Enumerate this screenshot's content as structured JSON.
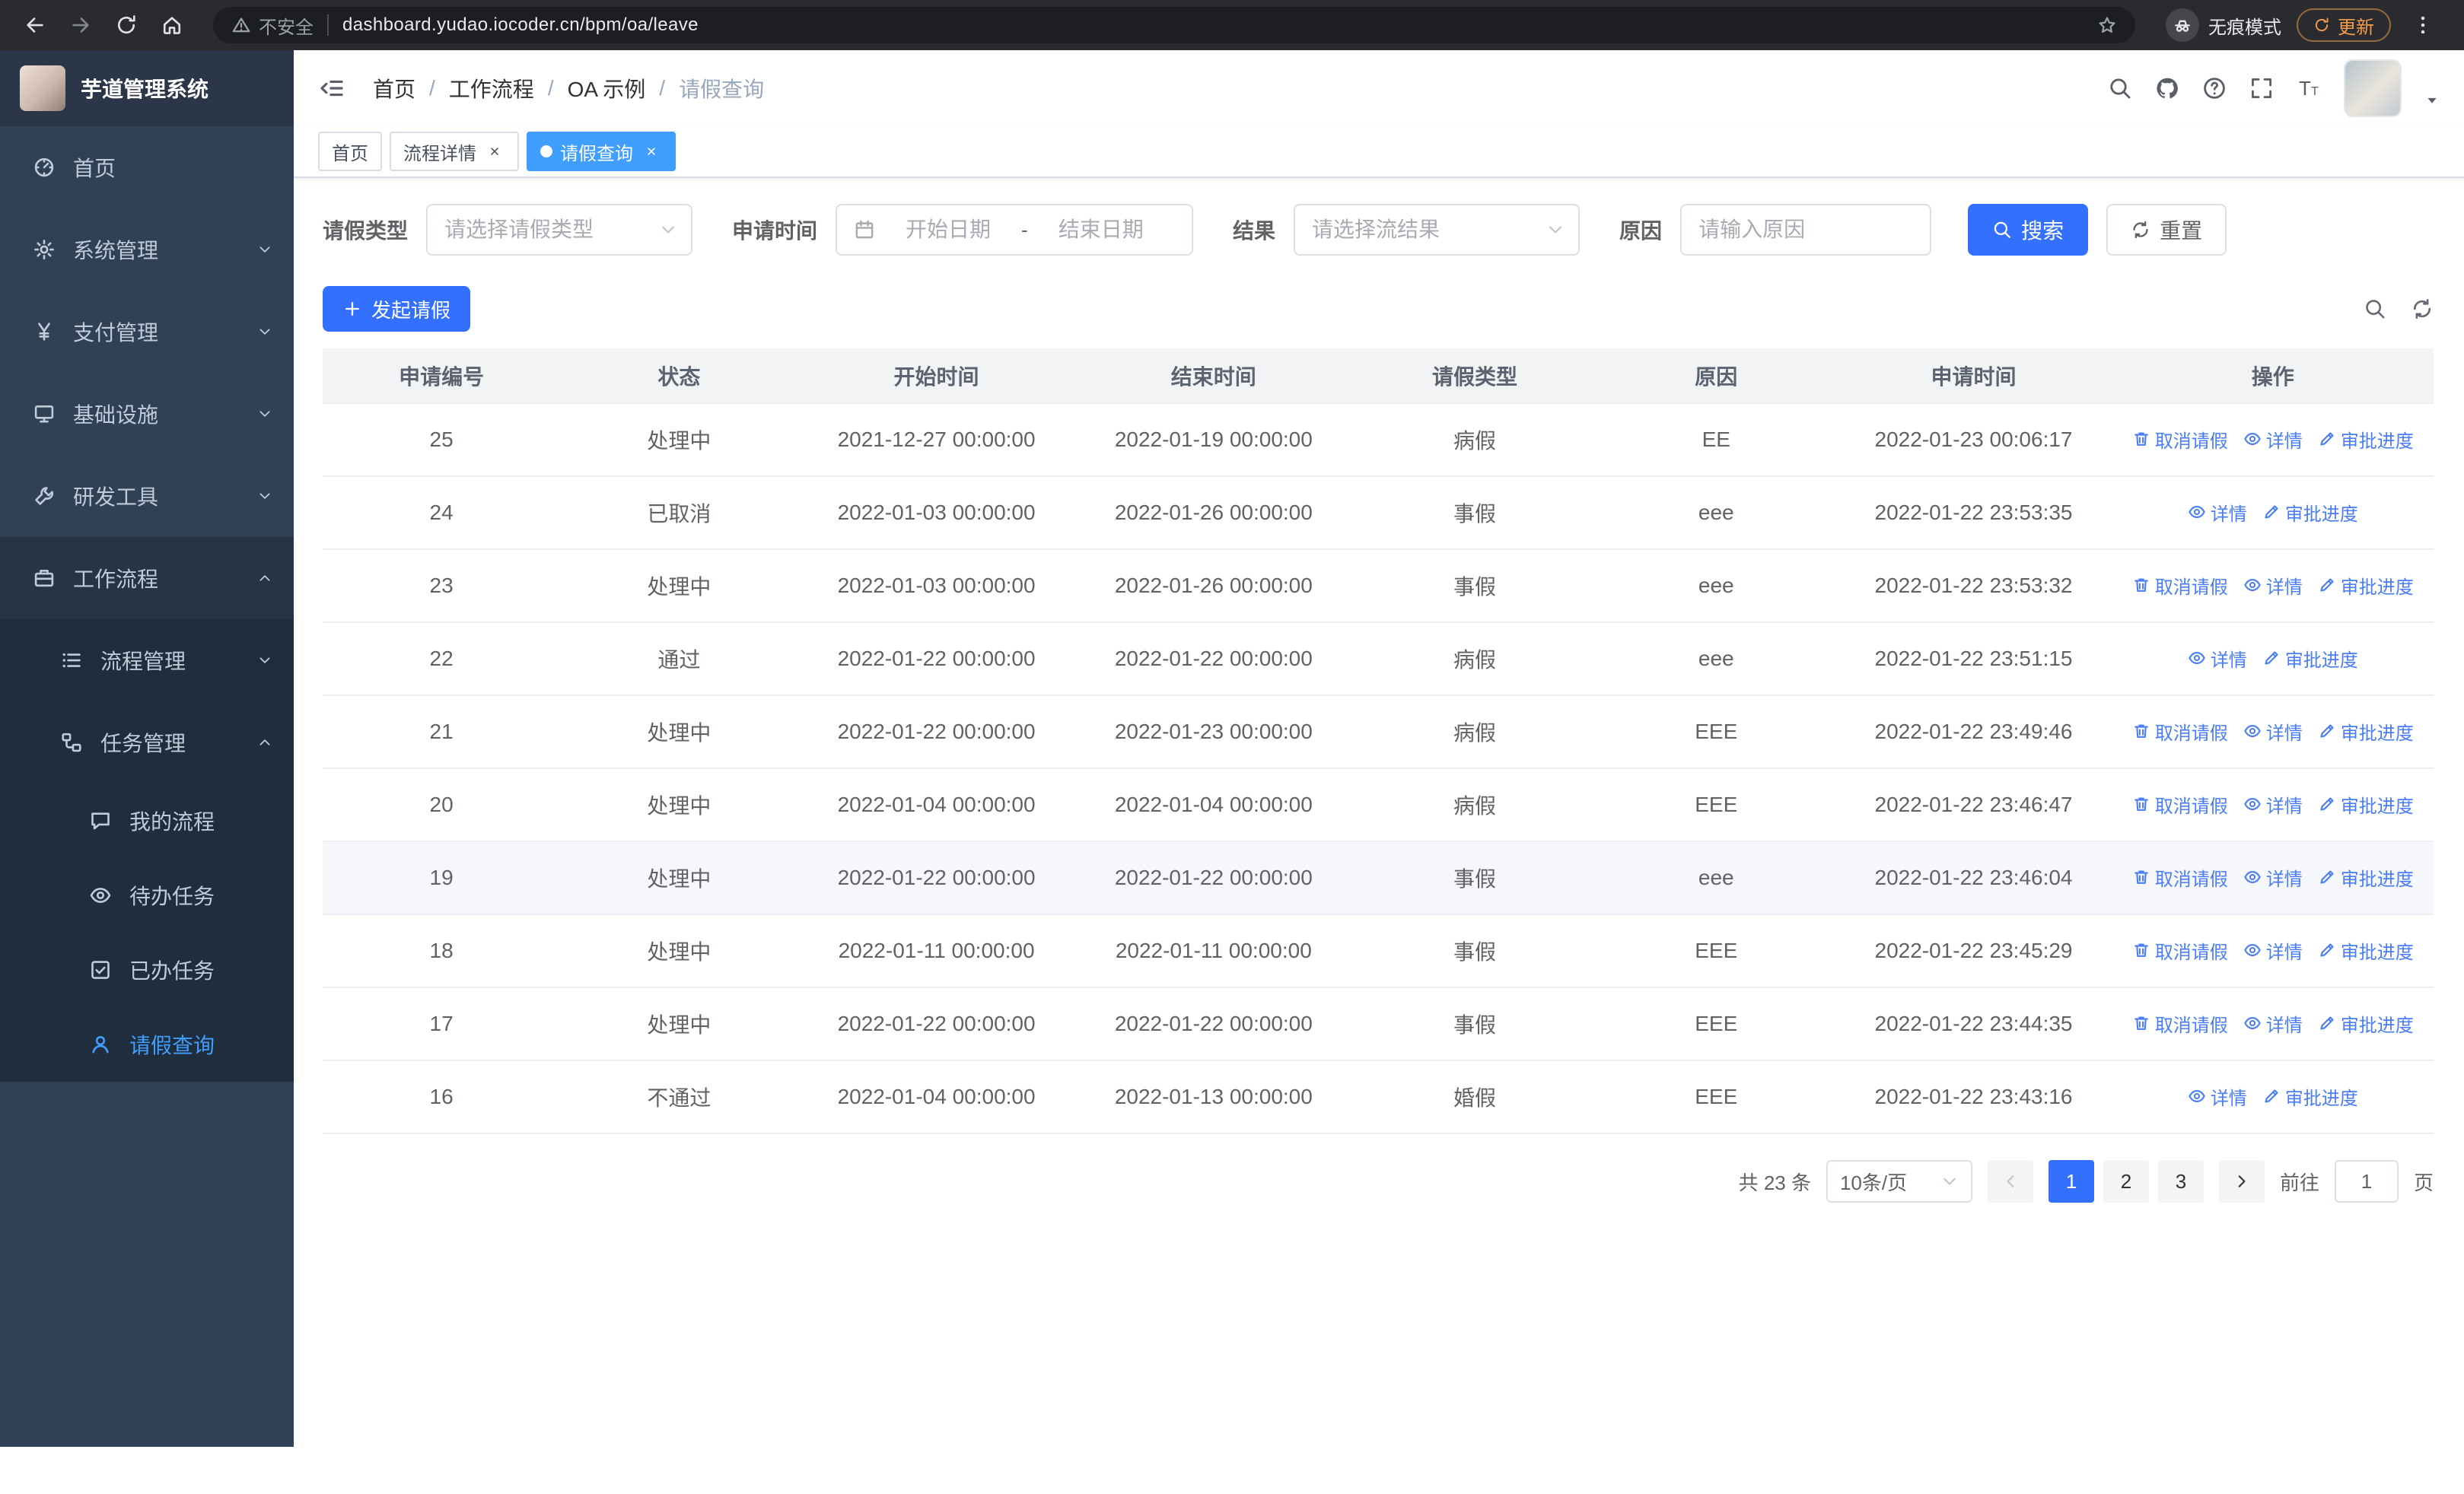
{
  "colors": {
    "primary_button": "#3370ff",
    "link_blue": "#4a7df6",
    "tag_active": "#409eff",
    "sidebar_bg": "#304156",
    "submenu_bg": "#1f2d3d",
    "sidebar_text": "#bfcbd9"
  },
  "browser": {
    "security_warning": "不安全",
    "url": "dashboard.yudao.iocoder.cn/bpm/oa/leave",
    "incognito_label": "无痕模式",
    "update_label": "更新"
  },
  "sidebar": {
    "logo_title": "芋道管理系统",
    "items": [
      {
        "label": "首页",
        "icon": "dashboard-icon",
        "level": 1
      },
      {
        "label": "系统管理",
        "icon": "gear-icon",
        "level": 1,
        "arrow": "down"
      },
      {
        "label": "支付管理",
        "icon": "yen-icon",
        "level": 1,
        "arrow": "down"
      },
      {
        "label": "基础设施",
        "icon": "infra-icon",
        "level": 1,
        "arrow": "down"
      },
      {
        "label": "研发工具",
        "icon": "tools-icon",
        "level": 1,
        "arrow": "down"
      },
      {
        "label": "工作流程",
        "icon": "workflow-icon",
        "level": 1,
        "arrow": "up",
        "open": true
      },
      {
        "label": "流程管理",
        "icon": "process-icon",
        "level": 2,
        "arrow": "down"
      },
      {
        "label": "任务管理",
        "icon": "task-icon",
        "level": 2,
        "arrow": "up"
      },
      {
        "label": "我的流程",
        "icon": "chat-icon",
        "level": 3
      },
      {
        "label": "待办任务",
        "icon": "eye-icon",
        "level": 3
      },
      {
        "label": "已办任务",
        "icon": "done-icon",
        "level": 3
      },
      {
        "label": "请假查询",
        "icon": "user-icon",
        "level": 3,
        "active": true
      }
    ]
  },
  "navbar": {
    "breadcrumb": [
      "首页",
      "工作流程",
      "OA 示例",
      "请假查询"
    ],
    "separator": "/"
  },
  "tags": [
    {
      "label": "首页",
      "closable": false,
      "active": false
    },
    {
      "label": "流程详情",
      "closable": true,
      "active": false
    },
    {
      "label": "请假查询",
      "closable": true,
      "active": true
    }
  ],
  "filters": {
    "leave_type_label": "请假类型",
    "leave_type_placeholder": "请选择请假类型",
    "apply_time_label": "申请时间",
    "start_placeholder": "开始日期",
    "range_separator": "-",
    "end_placeholder": "结束日期",
    "result_label": "结果",
    "result_placeholder": "请选择流结果",
    "reason_label": "原因",
    "reason_placeholder": "请输入原因",
    "search_label": "搜索",
    "reset_label": "重置"
  },
  "toolbar": {
    "create_label": "发起请假"
  },
  "table": {
    "columns": [
      "申请编号",
      "状态",
      "开始时间",
      "结束时间",
      "请假类型",
      "原因",
      "申请时间",
      "操作"
    ],
    "op_defs": {
      "cancel": {
        "label": "取消请假",
        "icon": "trash-icon"
      },
      "detail": {
        "label": "详情",
        "icon": "eye-icon"
      },
      "progress": {
        "label": "审批进度",
        "icon": "pen-icon"
      }
    },
    "rows": [
      {
        "id": "25",
        "status": "处理中",
        "start": "2021-12-27 00:00:00",
        "end": "2022-01-19 00:00:00",
        "type": "病假",
        "reason": "EE",
        "applied": "2022-01-23 00:06:17",
        "ops": [
          "cancel",
          "detail",
          "progress"
        ]
      },
      {
        "id": "24",
        "status": "已取消",
        "start": "2022-01-03 00:00:00",
        "end": "2022-01-26 00:00:00",
        "type": "事假",
        "reason": "eee",
        "applied": "2022-01-22 23:53:35",
        "ops": [
          "detail",
          "progress"
        ]
      },
      {
        "id": "23",
        "status": "处理中",
        "start": "2022-01-03 00:00:00",
        "end": "2022-01-26 00:00:00",
        "type": "事假",
        "reason": "eee",
        "applied": "2022-01-22 23:53:32",
        "ops": [
          "cancel",
          "detail",
          "progress"
        ]
      },
      {
        "id": "22",
        "status": "通过",
        "start": "2022-01-22 00:00:00",
        "end": "2022-01-22 00:00:00",
        "type": "病假",
        "reason": "eee",
        "applied": "2022-01-22 23:51:15",
        "ops": [
          "detail",
          "progress"
        ]
      },
      {
        "id": "21",
        "status": "处理中",
        "start": "2022-01-22 00:00:00",
        "end": "2022-01-23 00:00:00",
        "type": "病假",
        "reason": "EEE",
        "applied": "2022-01-22 23:49:46",
        "ops": [
          "cancel",
          "detail",
          "progress"
        ]
      },
      {
        "id": "20",
        "status": "处理中",
        "start": "2022-01-04 00:00:00",
        "end": "2022-01-04 00:00:00",
        "type": "病假",
        "reason": "EEE",
        "applied": "2022-01-22 23:46:47",
        "ops": [
          "cancel",
          "detail",
          "progress"
        ]
      },
      {
        "id": "19",
        "status": "处理中",
        "start": "2022-01-22 00:00:00",
        "end": "2022-01-22 00:00:00",
        "type": "事假",
        "reason": "eee",
        "applied": "2022-01-22 23:46:04",
        "ops": [
          "cancel",
          "detail",
          "progress"
        ],
        "highlighted": true
      },
      {
        "id": "18",
        "status": "处理中",
        "start": "2022-01-11 00:00:00",
        "end": "2022-01-11 00:00:00",
        "type": "事假",
        "reason": "EEE",
        "applied": "2022-01-22 23:45:29",
        "ops": [
          "cancel",
          "detail",
          "progress"
        ]
      },
      {
        "id": "17",
        "status": "处理中",
        "start": "2022-01-22 00:00:00",
        "end": "2022-01-22 00:00:00",
        "type": "事假",
        "reason": "EEE",
        "applied": "2022-01-22 23:44:35",
        "ops": [
          "cancel",
          "detail",
          "progress"
        ]
      },
      {
        "id": "16",
        "status": "不通过",
        "start": "2022-01-04 00:00:00",
        "end": "2022-01-13 00:00:00",
        "type": "婚假",
        "reason": "EEE",
        "applied": "2022-01-22 23:43:16",
        "ops": [
          "detail",
          "progress"
        ]
      }
    ]
  },
  "pagination": {
    "total_text": "共 23 条",
    "page_size": "10条/页",
    "pages": [
      "1",
      "2",
      "3"
    ],
    "active_page": "1",
    "goto_label": "前往",
    "goto_value": "1",
    "page_unit": "页"
  }
}
